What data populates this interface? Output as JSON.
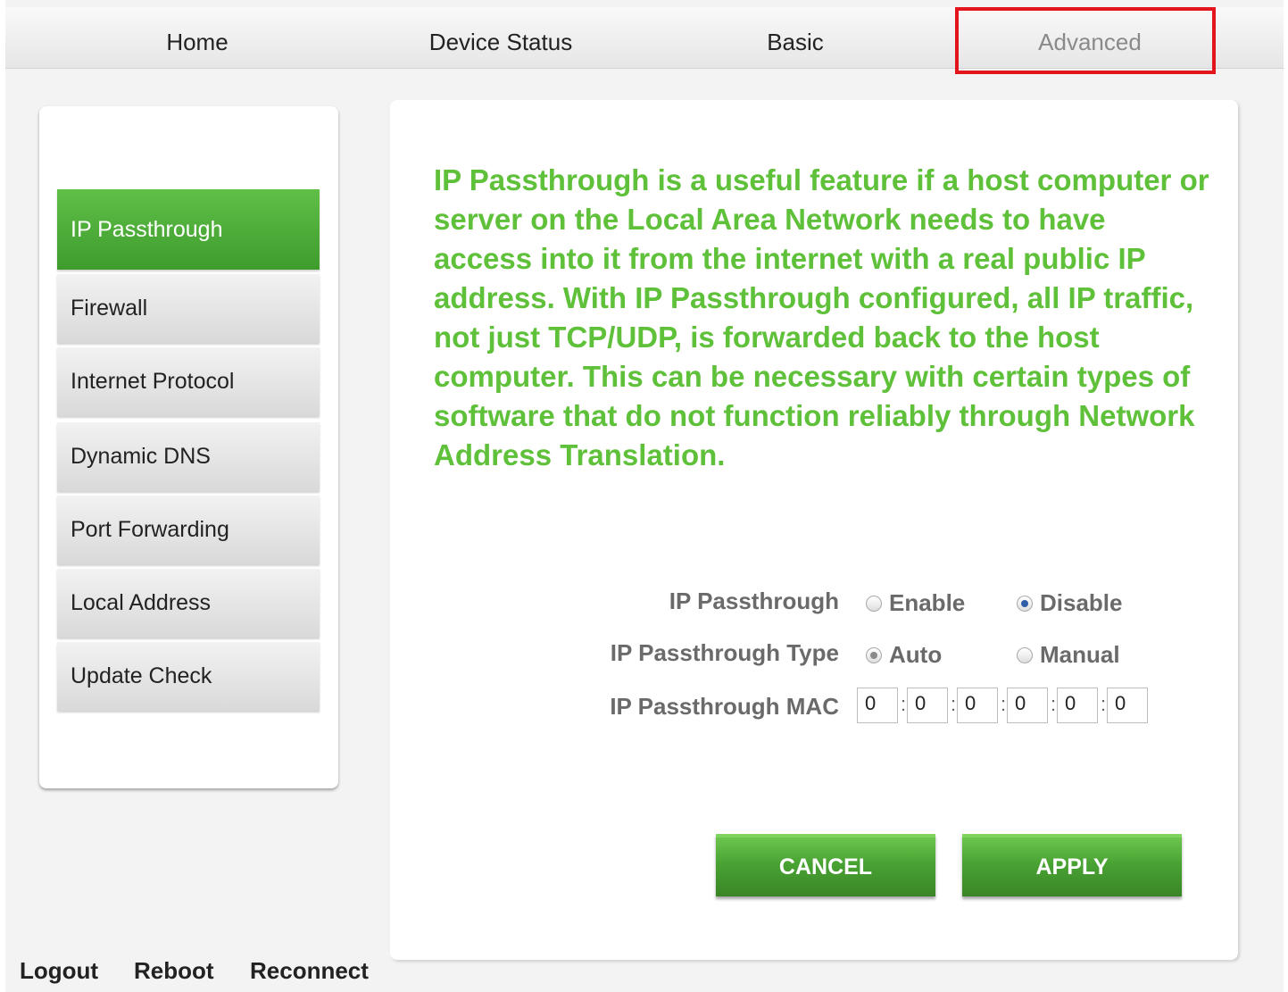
{
  "nav": {
    "home": "Home",
    "device_status": "Device Status",
    "basic": "Basic",
    "advanced": "Advanced"
  },
  "sidebar": {
    "items": [
      {
        "label": "IP Passthrough"
      },
      {
        "label": "Firewall"
      },
      {
        "label": "Internet Protocol"
      },
      {
        "label": "Dynamic DNS"
      },
      {
        "label": "Port Forwarding"
      },
      {
        "label": "Local Address"
      },
      {
        "label": "Update Check"
      }
    ]
  },
  "main": {
    "description": "IP Passthrough is a useful feature if a host computer or server on the Local Area Network needs to have access into it from the internet with a real public IP address. With IP Passthrough configured, all IP traffic, not just TCP/UDP, is forwarded back to the host computer. This can be necessary with certain types of software that do not function reliably through Network Address Translation.",
    "form": {
      "passthrough_label": "IP Passthrough",
      "enable_label": "Enable",
      "disable_label": "Disable",
      "passthrough_selected": "Disable",
      "type_label": "IP Passthrough Type",
      "auto_label": "Auto",
      "manual_label": "Manual",
      "type_selected": "Auto",
      "mac_label": "IP Passthrough MAC",
      "mac_values": [
        "0",
        "0",
        "0",
        "0",
        "0",
        "0"
      ],
      "mac_separator": ":"
    },
    "buttons": {
      "cancel": "CANCEL",
      "apply": "APPLY"
    }
  },
  "footer": {
    "logout": "Logout",
    "reboot": "Reboot",
    "reconnect": "Reconnect"
  },
  "colors": {
    "accent_green": "#5fc03a",
    "highlight_red": "#e3141b"
  }
}
